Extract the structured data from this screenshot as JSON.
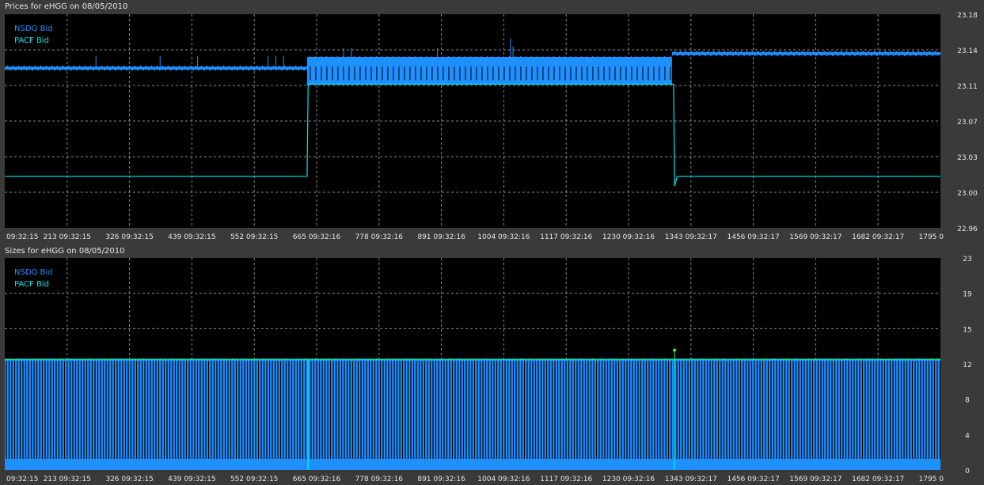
{
  "colors": {
    "background": "#3a3a3a",
    "plot_bg": "#000000",
    "grid": "#8a8a8a",
    "text": "#e6e6e6",
    "nsdq": "#1e90ff",
    "pacf": "#00e5ee",
    "size_markers": "#33ff33"
  },
  "chart_data": [
    {
      "type": "line",
      "title": "Prices for  eHGG  on  08/05/2010",
      "xlabel": "",
      "ylabel": "",
      "x_tick_labels": [
        "09:32:15",
        "213 09:32:15",
        "326 09:32:15",
        "439 09:32:15",
        "552 09:32:15",
        "665 09:32:16",
        "778 09:32:16",
        "891 09:32:16",
        "1004 09:32:16",
        "1117 09:32:16",
        "1230 09:32:16",
        "1343 09:32:17",
        "1456 09:32:17",
        "1569 09:32:17",
        "1682 09:32:17",
        "1795 0"
      ],
      "y_tick_labels": [
        "23.18",
        "23.14",
        "23.11",
        "23.07",
        "23.03",
        "23.00",
        "22.96"
      ],
      "ylim": [
        22.96,
        23.18
      ],
      "xlim": [
        0,
        1795
      ],
      "grid": true,
      "legend_position": "top-left",
      "series": [
        {
          "name": "NSDQ Bid",
          "color": "#1e90ff",
          "segments": [
            {
              "x": [
                0,
                580
              ],
              "low": 23.123,
              "high": 23.126
            },
            {
              "x": [
                580,
                1280
              ],
              "low": 23.108,
              "high": 23.136
            },
            {
              "x": [
                1280,
                1795
              ],
              "low": 23.138,
              "high": 23.141
            }
          ],
          "spikes": [
            {
              "x": 175,
              "y": 23.137
            },
            {
              "x": 298,
              "y": 23.137
            },
            {
              "x": 370,
              "y": 23.137
            },
            {
              "x": 505,
              "y": 23.137
            },
            {
              "x": 520,
              "y": 23.137
            },
            {
              "x": 535,
              "y": 23.137
            },
            {
              "x": 650,
              "y": 23.145
            },
            {
              "x": 665,
              "y": 23.145
            },
            {
              "x": 830,
              "y": 23.145
            },
            {
              "x": 970,
              "y": 23.155
            },
            {
              "x": 975,
              "y": 23.147
            }
          ]
        },
        {
          "name": "PACF Bid",
          "color": "#00e5ee",
          "points": [
            {
              "x": 0,
              "y": 23.013
            },
            {
              "x": 580,
              "y": 23.013
            },
            {
              "x": 582,
              "y": 23.108
            },
            {
              "x": 1283,
              "y": 23.108
            },
            {
              "x": 1285,
              "y": 23.003
            },
            {
              "x": 1290,
              "y": 23.013
            },
            {
              "x": 1795,
              "y": 23.013
            }
          ]
        }
      ]
    },
    {
      "type": "bar",
      "title": "Sizes for  eHGG  on  08/05/2010",
      "xlabel": "",
      "ylabel": "",
      "x_tick_labels": [
        "09:32:15",
        "213 09:32:15",
        "326 09:32:15",
        "439 09:32:15",
        "552 09:32:15",
        "665 09:32:16",
        "778 09:32:16",
        "891 09:32:16",
        "1004 09:32:16",
        "1117 09:32:16",
        "1230 09:32:16",
        "1343 09:32:17",
        "1456 09:32:17",
        "1569 09:32:17",
        "1682 09:32:17",
        "1795 0"
      ],
      "y_tick_labels": [
        "23",
        "19",
        "15",
        "12",
        "8",
        "4",
        "0"
      ],
      "ylim": [
        0,
        23
      ],
      "xlim": [
        0,
        1795
      ],
      "grid": true,
      "legend_position": "top-left",
      "series": [
        {
          "name": "NSDQ Bid",
          "color": "#1e90ff",
          "value": 12,
          "x_range": [
            0,
            1795
          ],
          "outlier": {
            "x": 1285,
            "y": 13
          }
        },
        {
          "name": "PACF Bid",
          "color": "#00e5ee",
          "value": 12,
          "x_range": [
            0,
            1795
          ]
        }
      ]
    }
  ]
}
